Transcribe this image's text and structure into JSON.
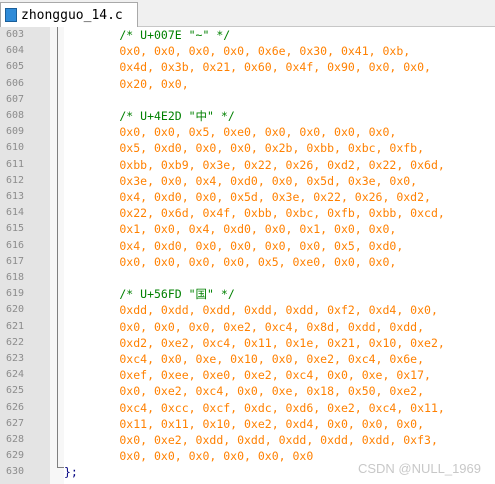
{
  "tab": {
    "label": "zhongguo_14.c",
    "icon": "c-file-icon"
  },
  "colors": {
    "comment": "#008000",
    "hex": "#ff8000",
    "plain": "#000080",
    "gutter": "#e4e4e4"
  },
  "lines": [
    {
      "num": "603",
      "text": "        /* U+007E \"~\" */",
      "kind": "comment"
    },
    {
      "num": "604",
      "text": "        0x0, 0x0, 0x0, 0x0, 0x6e, 0x30, 0x41, 0xb,",
      "kind": "hex"
    },
    {
      "num": "605",
      "text": "        0x4d, 0x3b, 0x21, 0x60, 0x4f, 0x90, 0x0, 0x0,",
      "kind": "hex"
    },
    {
      "num": "606",
      "text": "        0x20, 0x0,",
      "kind": "hex"
    },
    {
      "num": "607",
      "text": "",
      "kind": "hex"
    },
    {
      "num": "608",
      "text": "        /* U+4E2D \"中\" */",
      "kind": "comment"
    },
    {
      "num": "609",
      "text": "        0x0, 0x0, 0x5, 0xe0, 0x0, 0x0, 0x0, 0x0,",
      "kind": "hex"
    },
    {
      "num": "610",
      "text": "        0x5, 0xd0, 0x0, 0x0, 0x2b, 0xbb, 0xbc, 0xfb,",
      "kind": "hex"
    },
    {
      "num": "611",
      "text": "        0xbb, 0xb9, 0x3e, 0x22, 0x26, 0xd2, 0x22, 0x6d,",
      "kind": "hex"
    },
    {
      "num": "612",
      "text": "        0x3e, 0x0, 0x4, 0xd0, 0x0, 0x5d, 0x3e, 0x0,",
      "kind": "hex"
    },
    {
      "num": "613",
      "text": "        0x4, 0xd0, 0x0, 0x5d, 0x3e, 0x22, 0x26, 0xd2,",
      "kind": "hex"
    },
    {
      "num": "614",
      "text": "        0x22, 0x6d, 0x4f, 0xbb, 0xbc, 0xfb, 0xbb, 0xcd,",
      "kind": "hex"
    },
    {
      "num": "615",
      "text": "        0x1, 0x0, 0x4, 0xd0, 0x0, 0x1, 0x0, 0x0,",
      "kind": "hex"
    },
    {
      "num": "616",
      "text": "        0x4, 0xd0, 0x0, 0x0, 0x0, 0x0, 0x5, 0xd0,",
      "kind": "hex"
    },
    {
      "num": "617",
      "text": "        0x0, 0x0, 0x0, 0x0, 0x5, 0xe0, 0x0, 0x0,",
      "kind": "hex"
    },
    {
      "num": "618",
      "text": "",
      "kind": "hex"
    },
    {
      "num": "619",
      "text": "        /* U+56FD \"国\" */",
      "kind": "comment"
    },
    {
      "num": "620",
      "text": "        0xdd, 0xdd, 0xdd, 0xdd, 0xdd, 0xf2, 0xd4, 0x0,",
      "kind": "hex"
    },
    {
      "num": "621",
      "text": "        0x0, 0x0, 0x0, 0xe2, 0xc4, 0x8d, 0xdd, 0xdd,",
      "kind": "hex"
    },
    {
      "num": "622",
      "text": "        0xd2, 0xe2, 0xc4, 0x11, 0x1e, 0x21, 0x10, 0xe2,",
      "kind": "hex"
    },
    {
      "num": "623",
      "text": "        0xc4, 0x0, 0xe, 0x10, 0x0, 0xe2, 0xc4, 0x6e,",
      "kind": "hex"
    },
    {
      "num": "624",
      "text": "        0xef, 0xee, 0xe0, 0xe2, 0xc4, 0x0, 0xe, 0x17,",
      "kind": "hex"
    },
    {
      "num": "625",
      "text": "        0x0, 0xe2, 0xc4, 0x0, 0xe, 0x18, 0x50, 0xe2,",
      "kind": "hex"
    },
    {
      "num": "626",
      "text": "        0xc4, 0xcc, 0xcf, 0xdc, 0xd6, 0xe2, 0xc4, 0x11,",
      "kind": "hex"
    },
    {
      "num": "627",
      "text": "        0x11, 0x11, 0x10, 0xe2, 0xd4, 0x0, 0x0, 0x0,",
      "kind": "hex"
    },
    {
      "num": "628",
      "text": "        0x0, 0xe2, 0xdd, 0xdd, 0xdd, 0xdd, 0xdd, 0xf3,",
      "kind": "hex"
    },
    {
      "num": "629",
      "text": "        0x0, 0x0, 0x0, 0x0, 0x0, 0x0",
      "kind": "hex"
    },
    {
      "num": "630",
      "text": "};",
      "kind": "plain"
    }
  ],
  "watermark": "CSDN @NULL_1969"
}
